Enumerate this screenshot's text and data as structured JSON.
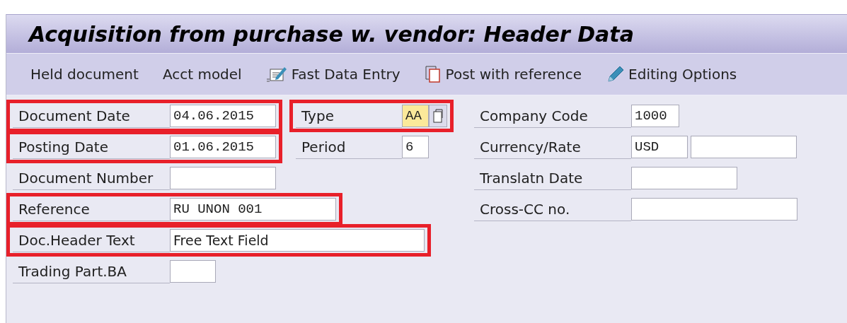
{
  "window": {
    "title": "Acquisition from purchase w. vendor: Header Data"
  },
  "toolbar": [
    {
      "label": "Held document"
    },
    {
      "label": "Acct model"
    },
    {
      "label": "Fast Data Entry"
    },
    {
      "label": "Post with reference"
    },
    {
      "label": "Editing Options"
    }
  ],
  "columns": [
    [
      {
        "label": "Document Date",
        "value": "04.06.2015",
        "highlighted": true,
        "focused": false
      },
      {
        "label": "Posting Date",
        "value": "01.06.2015",
        "highlighted": true,
        "focused": false
      },
      {
        "label": "Document Number",
        "highlighted": false,
        "focused": false
      },
      {
        "label": "Reference",
        "value": "RU UNON 001",
        "highlighted": true,
        "focused": false
      },
      {
        "label": "Doc.Header Text",
        "value": "Free Text Field",
        "highlighted": true,
        "focused": false
      },
      {
        "label": "Trading Part.BA",
        "highlighted": false,
        "focused": false
      }
    ],
    [
      {
        "label": "Type",
        "value": "AA",
        "highlighted": true,
        "focused": true
      },
      {
        "label": "Period",
        "value": "6",
        "highlighted": false,
        "focused": false
      }
    ],
    [
      {
        "label": "Company Code",
        "value": "1000",
        "highlighted": false,
        "focused": false
      },
      {
        "label": "Currency/Rate",
        "value": "USD",
        "highlighted": false,
        "focused": false
      },
      {
        "label": "Translatn Date",
        "highlighted": false,
        "focused": false
      },
      {
        "label": "Cross-CC no.",
        "highlighted": false,
        "focused": false
      }
    ]
  ]
}
